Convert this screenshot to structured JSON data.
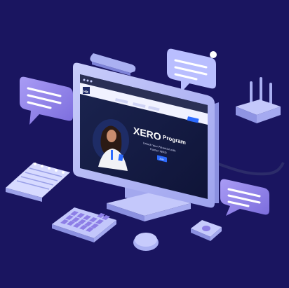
{
  "scene": {
    "background": "#1a1560",
    "accent_purple": "#8d7ee6",
    "accent_periwinkle": "#aab0f2"
  },
  "screen": {
    "logo_mark": "HX",
    "hero_title": "XERO",
    "hero_subtitle": "Program",
    "hero_tagline_line1": "Unlock Your Potential with",
    "hero_tagline_line2": "Hunter XERO",
    "cta_label": "Join",
    "nav_items": [
      "",
      "",
      ""
    ]
  }
}
